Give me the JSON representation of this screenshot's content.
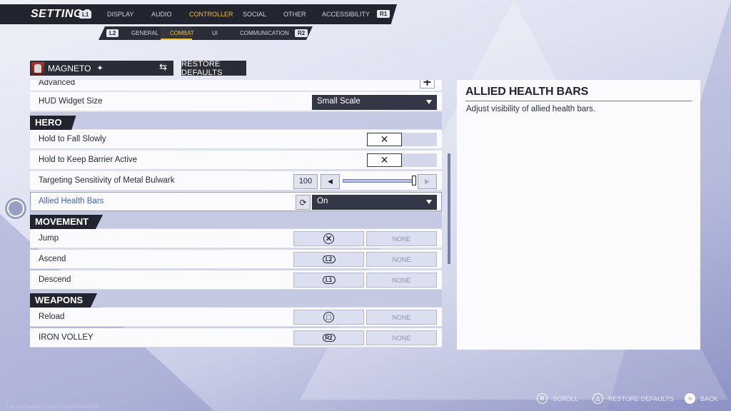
{
  "header": {
    "title": "SETTINGS",
    "left_bumper": "L1",
    "right_bumper": "R1",
    "tabs": [
      {
        "label": "DISPLAY"
      },
      {
        "label": "AUDIO"
      },
      {
        "label": "CONTROLLER"
      },
      {
        "label": "SOCIAL"
      },
      {
        "label": "OTHER"
      },
      {
        "label": "ACCESSIBILITY"
      }
    ],
    "active_tab": "CONTROLLER"
  },
  "subheader": {
    "left_trigger": "L2",
    "right_trigger": "R2",
    "tabs": [
      {
        "label": "GENERAL"
      },
      {
        "label": "COMBAT"
      },
      {
        "label": "UI"
      },
      {
        "label": "COMMUNICATION"
      }
    ],
    "active_tab": "COMBAT"
  },
  "hero": {
    "name": "MAGNETO",
    "restore_label": "RESTORE DEFAULTS"
  },
  "list": {
    "advanced_label": "Advanced",
    "hud_widget": {
      "label": "HUD Widget Size",
      "value": "Small Scale"
    },
    "sections": {
      "hero": "HERO",
      "movement": "MOVEMENT",
      "weapons": "WEAPONS"
    },
    "hold_fall": {
      "label": "Hold to Fall Slowly",
      "toggle": "✕"
    },
    "hold_barrier": {
      "label": "Hold to Keep Barrier Active",
      "toggle": "✕"
    },
    "targeting": {
      "label": "Targeting Sensitivity of Metal Bulwark",
      "value": "100",
      "fill": 1.0
    },
    "allied_health": {
      "label": "Allied Health Bars",
      "value": "On"
    },
    "jump": {
      "label": "Jump",
      "primary": "✕",
      "secondary": "NONE"
    },
    "ascend": {
      "label": "Ascend",
      "primary": "L2",
      "secondary": "NONE"
    },
    "descend": {
      "label": "Descend",
      "primary": "L1",
      "secondary": "NONE"
    },
    "reload": {
      "label": "Reload",
      "primary": "□",
      "secondary": "NONE"
    },
    "iron_volley": {
      "label": "IRON VOLLEY",
      "primary": "R2",
      "secondary": "NONE"
    }
  },
  "detail": {
    "title": "ALLIED HEALTH BARS",
    "description": "Adjust visibility of allied health bars."
  },
  "footer": {
    "scroll": {
      "glyph": "R",
      "label": "SCROLL"
    },
    "restore": {
      "glyph": "△",
      "label": "RESTORE DEFAULTS"
    },
    "back": {
      "glyph": "○",
      "label": "BACK"
    }
  },
  "uid_text": "UID: 2147315502 | 1933877 | 2505231142-0100",
  "colors": {
    "accent": "#f2c12e",
    "selected_text": "#3e62c0",
    "panel_dark": "#22242f"
  }
}
